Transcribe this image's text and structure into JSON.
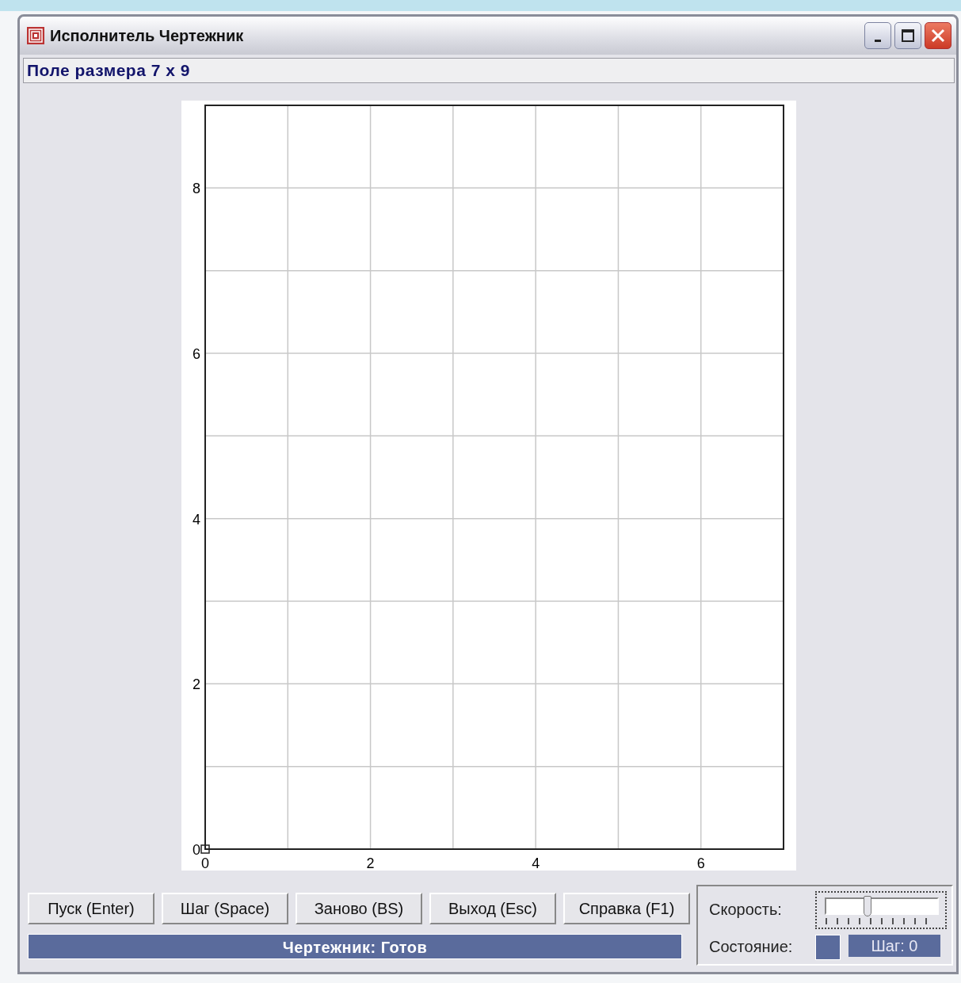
{
  "window": {
    "title": "Исполнитель Чертежник"
  },
  "field_info": "Поле размера 7 x 9",
  "field": {
    "chart_data": {
      "type": "scatter",
      "grid": true,
      "x": [
        0
      ],
      "values": [
        0
      ],
      "xlim": [
        0,
        7
      ],
      "ylim": [
        0,
        9
      ],
      "xticks": [
        0,
        2,
        4,
        6
      ],
      "yticks": [
        0,
        2,
        4,
        6,
        8
      ]
    }
  },
  "buttons": [
    "Пуск (Enter)",
    "Шаг (Space)",
    "Заново (BS)",
    "Выход (Esc)",
    "Справка (F1)"
  ],
  "status": "Чертежник: Готов",
  "speed": {
    "label": "Скорость:",
    "level": 0.37
  },
  "state": {
    "label": "Состояние:",
    "step": "Шаг: 0"
  }
}
